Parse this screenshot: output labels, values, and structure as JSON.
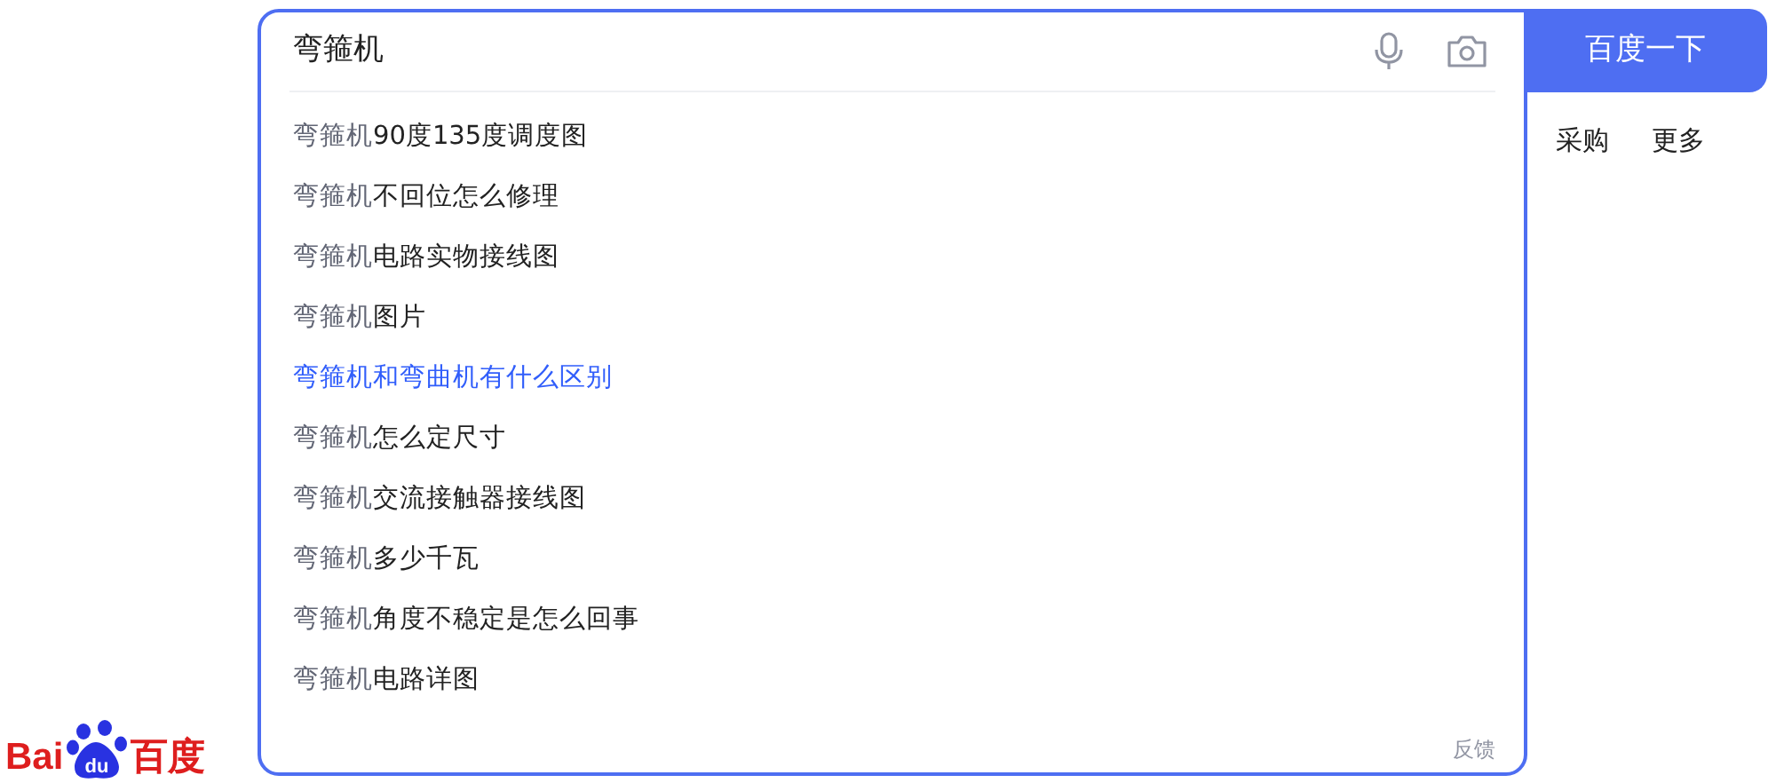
{
  "logo": {
    "text_left": "Bai",
    "paw_text": "du",
    "text_right": "百度"
  },
  "search": {
    "value": "弯箍机"
  },
  "search_button": "百度一下",
  "suggestions": [
    {
      "prefix": "弯箍机",
      "rest": "90度135度调度图",
      "selected": false
    },
    {
      "prefix": "弯箍机",
      "rest": "不回位怎么修理",
      "selected": false
    },
    {
      "prefix": "弯箍机",
      "rest": "电路实物接线图",
      "selected": false
    },
    {
      "prefix": "弯箍机",
      "rest": "图片",
      "selected": false
    },
    {
      "prefix": "弯箍机",
      "rest": "和弯曲机有什么区别",
      "selected": true
    },
    {
      "prefix": "弯箍机",
      "rest": "怎么定尺寸",
      "selected": false
    },
    {
      "prefix": "弯箍机",
      "rest": "交流接触器接线图",
      "selected": false
    },
    {
      "prefix": "弯箍机",
      "rest": "多少千瓦",
      "selected": false
    },
    {
      "prefix": "弯箍机",
      "rest": "角度不稳定是怎么回事",
      "selected": false
    },
    {
      "prefix": "弯箍机",
      "rest": "电路详图",
      "selected": false
    }
  ],
  "feedback": "反馈",
  "nav_links": [
    "采购",
    "更多"
  ]
}
